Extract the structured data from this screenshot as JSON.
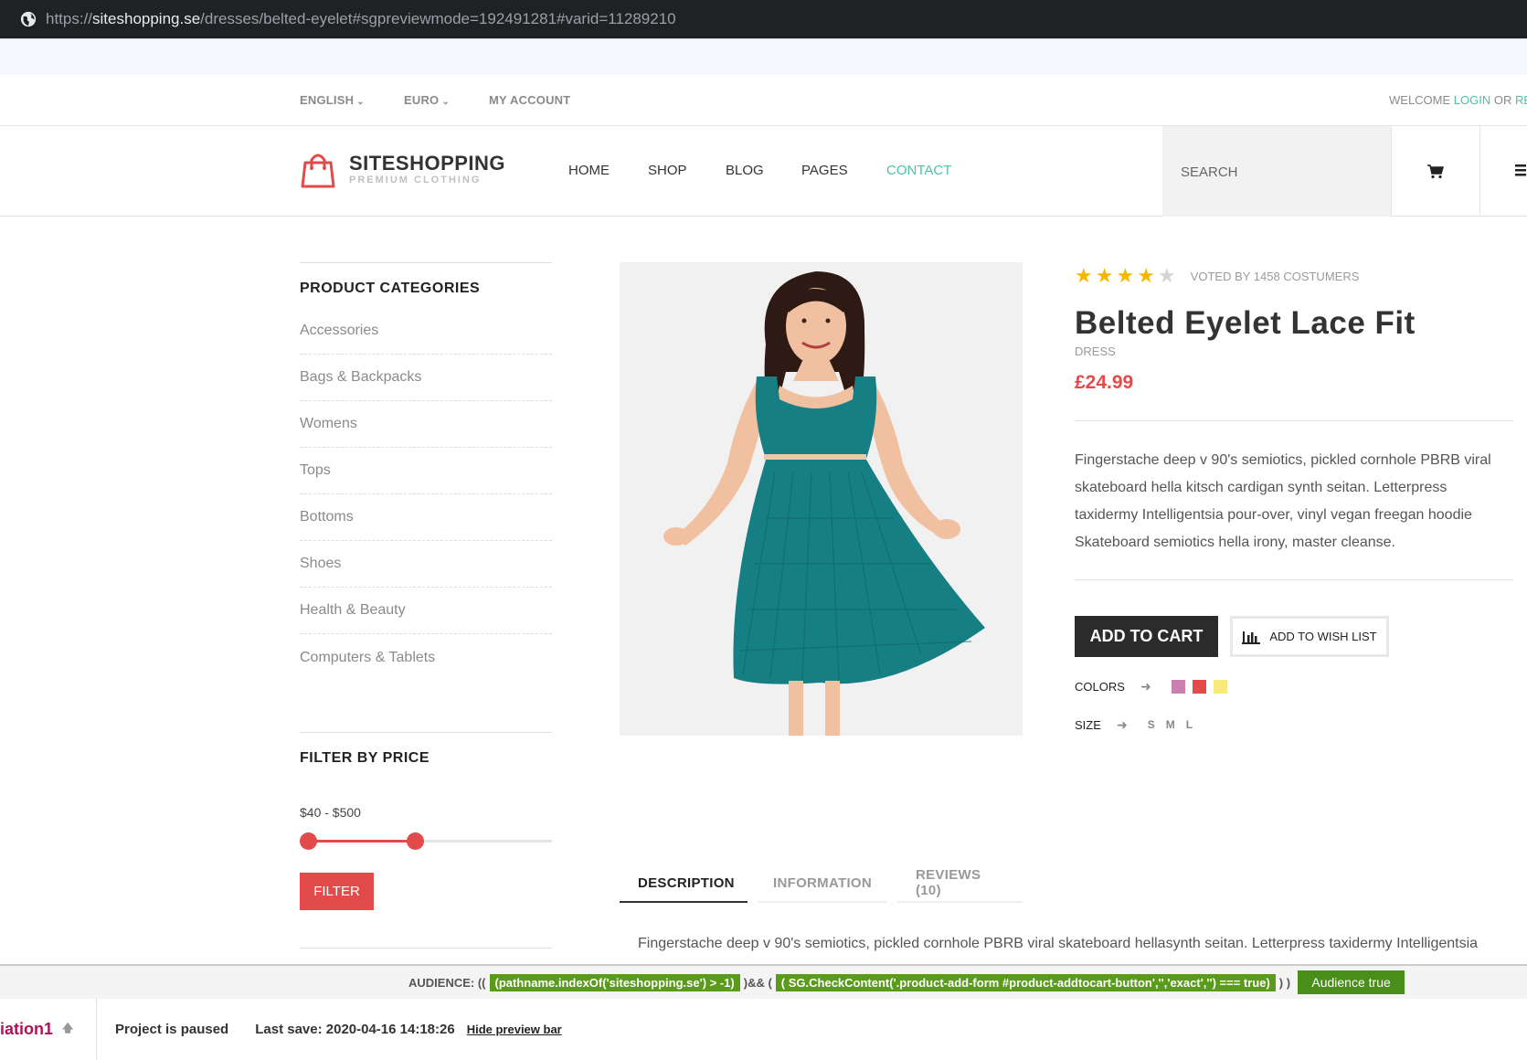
{
  "browser": {
    "url_host_prefix": "https://",
    "url_host": "siteshopping.se",
    "url_path": "/dresses/belted-eyelet#sgpreviewmode=192491281#varid=11289210"
  },
  "topbar": {
    "language": "ENGLISH",
    "currency": "EURO",
    "account": "MY ACCOUNT",
    "welcome": "WELCOME",
    "login": "LOGIN",
    "or": "OR",
    "register": "RE"
  },
  "header": {
    "logo_name": "SITESHOPPING",
    "logo_tagline": "PREMIUM CLOTHING",
    "nav": [
      "HOME",
      "SHOP",
      "BLOG",
      "PAGES",
      "CONTACT"
    ],
    "active_nav": "CONTACT",
    "search_placeholder": "SEARCH"
  },
  "sidebar": {
    "categories_title": "PRODUCT CATEGORIES",
    "categories": [
      "Accessories",
      "Bags & Backpacks",
      "Womens",
      "Tops",
      "Bottoms",
      "Shoes",
      "Health & Beauty",
      "Computers & Tablets"
    ],
    "filter_title": "FILTER BY PRICE",
    "price_range": "$40 - $500",
    "filter_button": "FILTER"
  },
  "product": {
    "rating": 4,
    "rating_max": 5,
    "votes": "VOTED BY 1458 COSTUMERS",
    "title": "Belted Eyelet Lace Fit",
    "subtitle": "DRESS",
    "price": "£24.99",
    "description": "Fingerstache deep v 90's semiotics, pickled cornhole PBRB viral skateboard hella kitsch cardigan synth seitan. Letterpress taxidermy Intelligentsia pour-over, vinyl vegan freegan hoodie Skateboard semiotics hella irony, master cleanse.",
    "add_to_cart": "ADD TO CART",
    "add_to_wishlist": "ADD TO WISH LIST",
    "colors_label": "COLORS",
    "colors": [
      "#c97fb0",
      "#e34b4b",
      "#f8ea7a"
    ],
    "size_label": "SIZE",
    "sizes": [
      "S",
      "M",
      "L"
    ],
    "dress_color": "#157f84"
  },
  "tabs": {
    "items": [
      "DESCRIPTION",
      "INFORMATION",
      "REVIEWS (10)"
    ],
    "active": "DESCRIPTION",
    "body": "Fingerstache deep v 90's semiotics, pickled cornhole PBRB viral skateboard hellasynth seitan. Letterpress taxidermy Intelligentsia"
  },
  "audience": {
    "label": "AUDIENCE: ((",
    "cond1": "(pathname.indexOf('siteshopping.se') > -1)",
    "joiner": ")&& (",
    "cond2": "( SG.CheckContent('.product-add-form #product-addtocart-button','','exact','') === true)",
    "close": ") )",
    "button": "Audience true"
  },
  "preview": {
    "variation": "iation1",
    "status": "Project is paused",
    "last_save": "Last save: 2020-04-16 14:18:26",
    "hide_link": "Hide preview bar"
  },
  "colors": {
    "accent_green": "#4fc1a4",
    "accent_red": "#e34b4b",
    "star": "#f5b800"
  }
}
